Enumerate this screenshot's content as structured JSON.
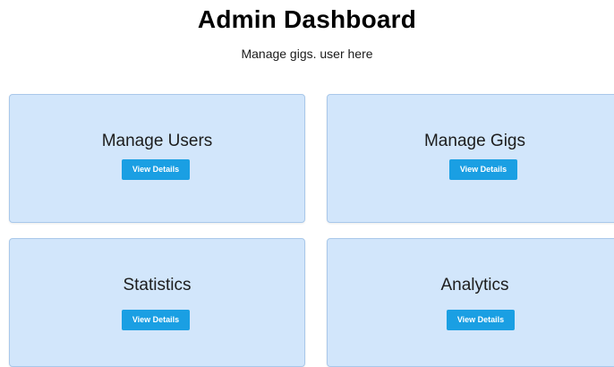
{
  "header": {
    "title": "Admin Dashboard",
    "subtitle": "Manage gigs. user here"
  },
  "cards": [
    {
      "title": "Manage Users",
      "button_label": "View Details"
    },
    {
      "title": "Manage Gigs",
      "button_label": "View Details"
    },
    {
      "title": "Statistics",
      "button_label": "View Details"
    },
    {
      "title": "Analytics",
      "button_label": "View Details"
    }
  ],
  "colors": {
    "card_background": "#d2e6fb",
    "card_border": "#a9c8ea",
    "button_background": "#1a9fe3",
    "button_text": "#ffffff"
  }
}
